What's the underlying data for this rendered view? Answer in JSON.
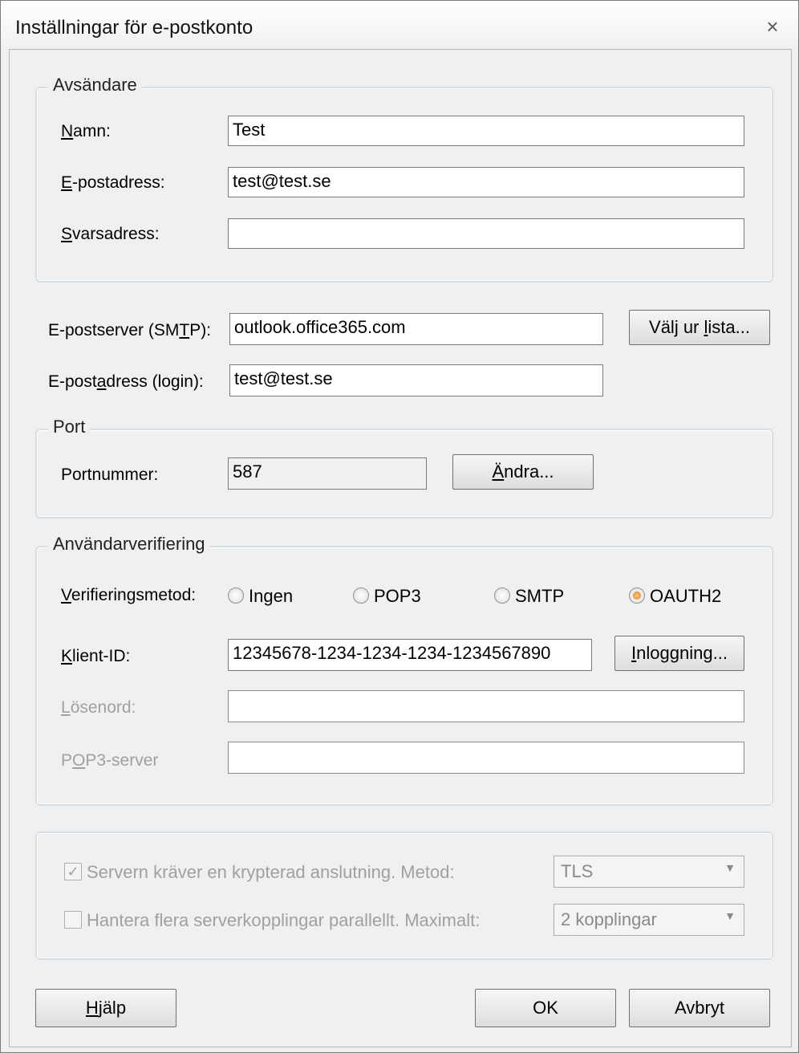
{
  "window": {
    "title": "Inställningar för e-postkonto",
    "close_icon": "×"
  },
  "sender": {
    "legend": "Avsändare",
    "name_label_u": "N",
    "name_label_rest": "amn:",
    "name_value": "Test",
    "email_label_u": "E",
    "email_label_rest": "-postadress:",
    "email_value": "test@test.se",
    "reply_label_u": "S",
    "reply_label_rest": "varsadress:",
    "reply_value": ""
  },
  "server": {
    "smtp_label_a": "E-postserver (SM",
    "smtp_label_u": "T",
    "smtp_label_b": "P):",
    "smtp_value": "outlook.office365.com",
    "choose_button_a": "Välj ur ",
    "choose_button_u": "l",
    "choose_button_b": "ista...",
    "login_label_a": "E-post",
    "login_label_u": "a",
    "login_label_b": "dress (login):",
    "login_value": "test@test.se"
  },
  "port": {
    "legend": "Port",
    "label": "Portnummer:",
    "value": "587",
    "change_button_u": "Ä",
    "change_button_rest": "ndra..."
  },
  "auth": {
    "legend": "Användarverifiering",
    "method_label_u": "V",
    "method_label_rest": "erifieringsmetod:",
    "options": [
      "Ingen",
      "POP3",
      "SMTP",
      "OAUTH2"
    ],
    "selected": "OAUTH2",
    "client_label_u": "K",
    "client_label_rest": "lient-ID:",
    "client_value": "12345678-1234-1234-1234-1234567890",
    "login_button_u": "I",
    "login_button_rest": "nloggning...",
    "password_label_u": "L",
    "password_label_rest": "ösenord:",
    "password_value": "",
    "pop3_label_a": "P",
    "pop3_label_u": "O",
    "pop3_label_b": "P3-server",
    "pop3_value": ""
  },
  "options": {
    "encrypted_label": "Servern kräver en krypterad anslutning. Metod:",
    "encrypted_checked": true,
    "encrypted_method": "TLS",
    "parallel_label": "Hantera flera serverkopplingar parallellt. Maximalt:",
    "parallel_checked": false,
    "parallel_max": "2 kopplingar",
    "check_mark": "✓",
    "dropdown_arrow": "▼"
  },
  "buttons": {
    "help_u": "H",
    "help_rest": "jälp",
    "ok": "OK",
    "cancel": "Avbryt"
  }
}
